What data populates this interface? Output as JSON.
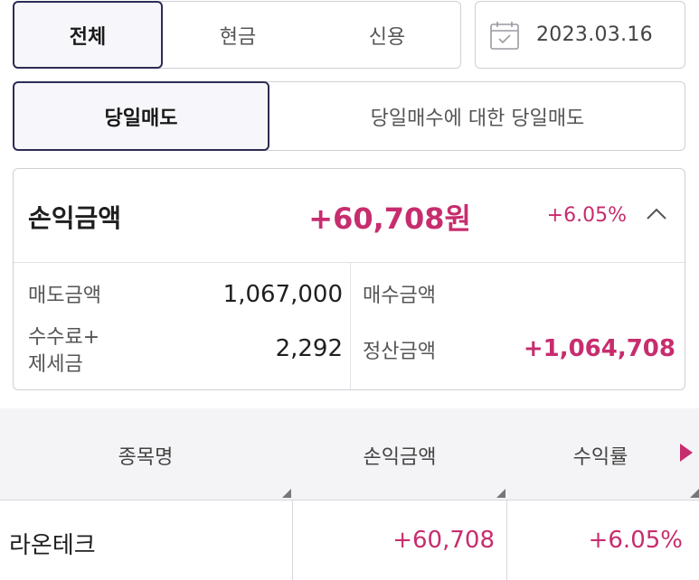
{
  "filter": {
    "type_tabs": [
      "전체",
      "현금",
      "신용"
    ],
    "selected_type": "전체",
    "date": "2023.03.16",
    "sell_tabs": [
      "당일매도",
      "당일매수에 대한 당일매도"
    ],
    "selected_sell": "당일매도"
  },
  "summary": {
    "title": "손익금액",
    "amount": "+60,708원",
    "rate": "+6.05%",
    "expanded": true,
    "sell_amount_label": "매도금액",
    "sell_amount": "1,067,000",
    "fee_tax_label_1": "수수료+",
    "fee_tax_label_2": "제세금",
    "fee_tax": "2,292",
    "buy_amount_label": "매수금액",
    "buy_amount": "",
    "settle_label": "정산금액",
    "settle_amount": "+1,064,708"
  },
  "table": {
    "columns": [
      "종목명",
      "손익금액",
      "수익률"
    ],
    "rows": [
      {
        "name": "라온테크",
        "profit": "+60,708",
        "rate": "+6.05%"
      }
    ]
  },
  "colors": {
    "accent": "#c72d6e",
    "active_border": "#2d2b55"
  },
  "icons": [
    "calendar-icon",
    "chevron-up-icon",
    "sort-triangle-icon",
    "scroll-right-arrow-icon"
  ]
}
